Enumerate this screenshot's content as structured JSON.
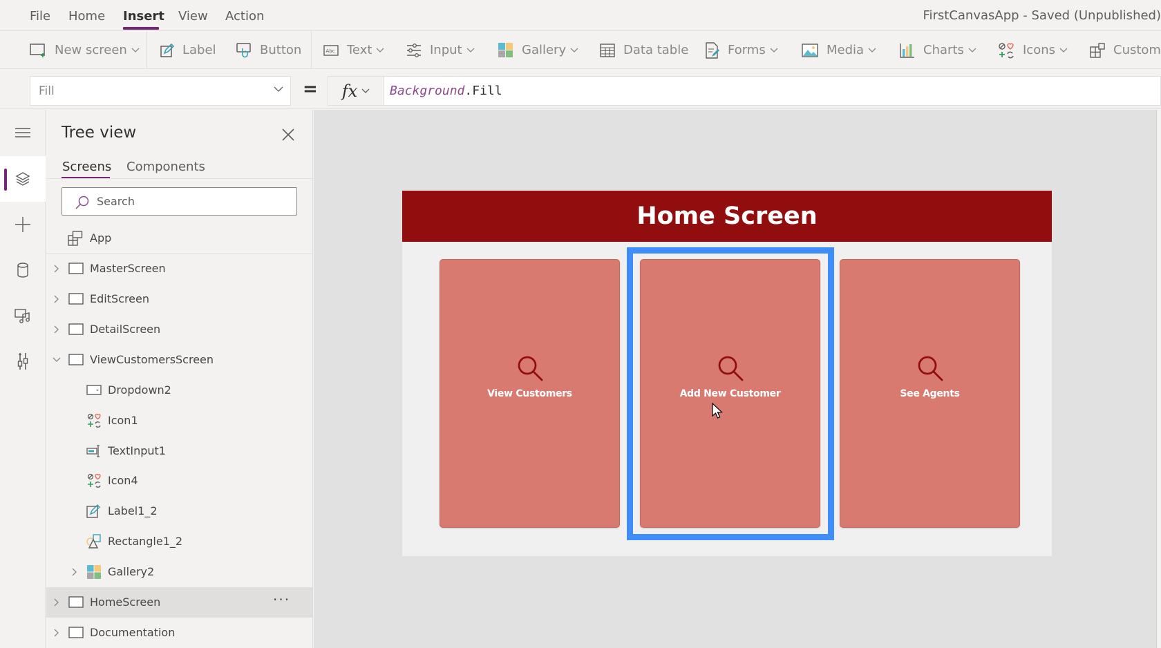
{
  "menu": {
    "items": [
      "File",
      "Home",
      "Insert",
      "View",
      "Action"
    ],
    "active": "Insert",
    "app_title": "FirstCanvasApp - Saved (Unpublished)"
  },
  "ribbon": {
    "items": [
      {
        "label": "New screen",
        "icon": "new-screen-icon",
        "dropdown": true
      },
      {
        "label": "Label",
        "icon": "label-edit-icon",
        "dropdown": false
      },
      {
        "label": "Button",
        "icon": "button-touch-icon",
        "dropdown": false
      },
      {
        "label": "Text",
        "icon": "text-abc-icon",
        "dropdown": true
      },
      {
        "label": "Input",
        "icon": "input-sliders-icon",
        "dropdown": true
      },
      {
        "label": "Gallery",
        "icon": "gallery-grid-icon",
        "dropdown": true
      },
      {
        "label": "Data table",
        "icon": "data-table-icon",
        "dropdown": false
      },
      {
        "label": "Forms",
        "icon": "forms-icon",
        "dropdown": true
      },
      {
        "label": "Media",
        "icon": "media-image-icon",
        "dropdown": true
      },
      {
        "label": "Charts",
        "icon": "charts-bar-icon",
        "dropdown": true
      },
      {
        "label": "Icons",
        "icon": "icons-set-icon",
        "dropdown": true
      },
      {
        "label": "Custom",
        "icon": "custom-component-icon",
        "dropdown": false
      }
    ]
  },
  "formula_bar": {
    "property": "Fill",
    "equals": "=",
    "fx": "fx",
    "formula_keyword": "Background",
    "formula_rest": ".Fill"
  },
  "rail": {
    "items": [
      "hamburger-menu-icon",
      "tree-view-layers-icon",
      "insert-plus-icon",
      "data-cylinder-icon",
      "media-icon",
      "advanced-tools-icon"
    ],
    "active": "tree-view-layers-icon"
  },
  "tree_view": {
    "title": "Tree view",
    "tabs": [
      "Screens",
      "Components"
    ],
    "active_tab": "Screens",
    "search_placeholder": "Search",
    "app_label": "App",
    "rows": [
      {
        "label": "MasterScreen",
        "type": "screen",
        "level": 0,
        "expander": "collapsed"
      },
      {
        "label": "EditScreen",
        "type": "screen",
        "level": 0,
        "expander": "collapsed"
      },
      {
        "label": "DetailScreen",
        "type": "screen",
        "level": 0,
        "expander": "collapsed"
      },
      {
        "label": "ViewCustomersScreen",
        "type": "screen",
        "level": 0,
        "expander": "expanded"
      },
      {
        "label": "Dropdown2",
        "type": "dropdown",
        "level": 1,
        "expander": "none"
      },
      {
        "label": "Icon1",
        "type": "icon",
        "level": 1,
        "expander": "none"
      },
      {
        "label": "TextInput1",
        "type": "textinput",
        "level": 1,
        "expander": "none"
      },
      {
        "label": "Icon4",
        "type": "icon",
        "level": 1,
        "expander": "none"
      },
      {
        "label": "Label1_2",
        "type": "label",
        "level": 1,
        "expander": "none"
      },
      {
        "label": "Rectangle1_2",
        "type": "shape",
        "level": 1,
        "expander": "none"
      },
      {
        "label": "Gallery2",
        "type": "gallery",
        "level": 1,
        "expander": "collapsed"
      },
      {
        "label": "HomeScreen",
        "type": "screen",
        "level": 0,
        "expander": "collapsed",
        "selected": true,
        "more": "···"
      },
      {
        "label": "Documentation",
        "type": "screen",
        "level": 0,
        "expander": "collapsed"
      }
    ]
  },
  "canvas": {
    "header_title": "Home Screen",
    "header_color": "#920e0e",
    "card_color": "#d87a70",
    "selection_color": "#3f8df8",
    "cards": [
      {
        "label": "View Customers",
        "icon": "search-icon"
      },
      {
        "label": "Add New Customer",
        "icon": "search-icon",
        "selected": true
      },
      {
        "label": "See Agents",
        "icon": "search-icon"
      }
    ]
  }
}
